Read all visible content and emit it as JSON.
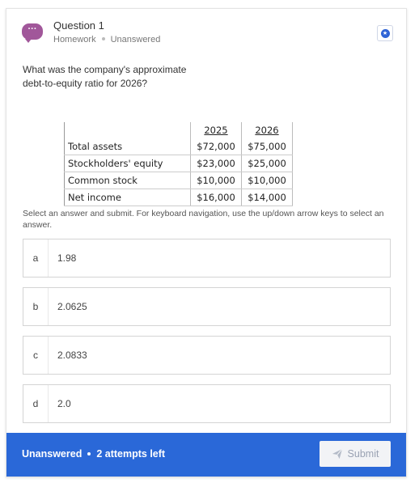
{
  "question": {
    "title": "Question 1",
    "category": "Homework",
    "status": "Unanswered",
    "prompt": "What was the company's approximate debt-to-equity ratio for 2026?"
  },
  "table": {
    "headers": [
      "2025",
      "2026"
    ],
    "rows": [
      {
        "label": "Total assets",
        "y2025": "$72,000",
        "y2026": "$75,000"
      },
      {
        "label": "Stockholders' equity",
        "y2025": "$23,000",
        "y2026": "$25,000"
      },
      {
        "label": "Common stock",
        "y2025": "$10,000",
        "y2026": "$10,000"
      },
      {
        "label": "Net income",
        "y2025": "$16,000",
        "y2026": "$14,000"
      }
    ]
  },
  "instructions": "Select an answer and submit. For keyboard navigation, use the up/down arrow keys to select an answer.",
  "options": [
    {
      "letter": "a",
      "value": "1.98"
    },
    {
      "letter": "b",
      "value": "2.0625"
    },
    {
      "letter": "c",
      "value": "2.0833"
    },
    {
      "letter": "d",
      "value": "2.0"
    }
  ],
  "footer": {
    "status": "Unanswered",
    "attempts": "2 attempts left",
    "submit_label": "Submit"
  },
  "colors": {
    "accent": "#2a68d8",
    "avatar": "#a1579a"
  },
  "icons": {
    "avatar": "chat-bubble-icon",
    "flag": "bookmark-icon",
    "submit": "send-icon"
  }
}
